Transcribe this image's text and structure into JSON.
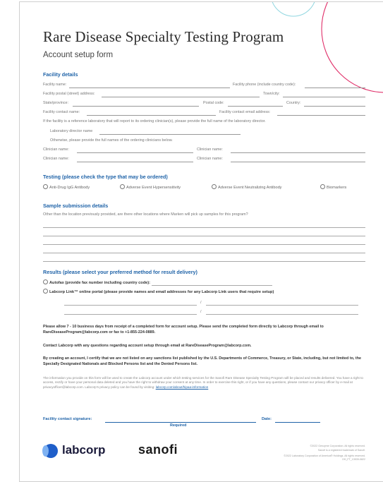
{
  "header": {
    "title": "Rare Disease Specialty Testing Program",
    "subtitle": "Account setup form"
  },
  "facility": {
    "heading": "Facility details",
    "name_label": "Facility name:",
    "phone_label": "Facility phone (include country code):",
    "postal_label": "Facility postal (street) address:",
    "town_label": "Town/city:",
    "state_label": "State/province:",
    "postcode_label": "Postal code:",
    "country_label": "Country:",
    "contact_name_label": "Facility contact name:",
    "contact_email_label": "Facility contact email address:",
    "reference_text": "If the facility is a reference laboratory that will report to its ordering clinician(s), please provide the full name of the laboratory director.",
    "director_label": "Laboratory director name",
    "otherwise_text": "Otherwise, please provide the full names of the ordering clinicians below.",
    "clinician_label": "Clinician name:"
  },
  "testing": {
    "heading": "Testing (please check the type that may be ordered)",
    "options": [
      "Anti-Drug IgG Antibody",
      "Adverse Event Hypersensitivity",
      "Adverse Event Neutralizing Antibody",
      "Biomarkers"
    ]
  },
  "sample": {
    "heading": "Sample submission details",
    "question": "Other than the location previously provided, are there other locations where Marken will pick up samples for this program?"
  },
  "results": {
    "heading": "Results (please select your preferred method for result delivery)",
    "autofax": "Autofax (provide fax number including country code):",
    "portal": "Labcorp Link™ online portal (please provide names and email addresses for any Labcorp Link users that require setup)",
    "slash": "/"
  },
  "notes": {
    "allow": "Please allow 7 - 10 business days from receipt of a completed form for account setup. Please send the completed form directly to Labcorp through email to RareDiseaseProgram@labcorp.com or fax to +1-855-224-0889.",
    "contact": "Contact Labcorp with any questions regarding account setup through email at RareDiseaseProgram@labcorp.com.",
    "certify": "By creating an account, I certify that we are not listed on any sanctions list published by the U.S. Departments of Commerce, Treasury, or State, including, but not limited to, the Specially Designated Nationals and Blocked Persons list and the Denied Persons list.",
    "privacy": "The information you provide on this form will be used to create the Labcorp account under which testing services for the Sanofi Rare Disease Specialty Testing Program will be placed and results delivered. You have a right to access, rectify or have your personal data deleted and you have the right to withdraw your consent at any time. In order to exercise this right, or if you have any questions, please contact our privacy officer by e-mail at privacyofficer@labcorp.com. Labcorp's privacy policy can be found by visiting:",
    "privacy_link": "labcorp.com/about/hipaa-information"
  },
  "signature": {
    "label": "Facility contact signature:",
    "date_label": "Date:",
    "required": "Required"
  },
  "footer": {
    "labcorp": "labcorp",
    "sanofi": "sanofi",
    "copy1": "©2022 Genzyme Corporation. All rights reserved.",
    "copy2": "Sanofi is a registered trademark of Sanofi.",
    "copy3": "©2022 Laboratory Corporation of America® Holdings. All rights reserved. OH_FT_13539-0822"
  },
  "colors": {
    "accent_blue": "#1f63a8",
    "deco_pink": "#e0306a",
    "deco_teal": "#8fd6e0",
    "labcorp_blue": "#1e5ec9"
  }
}
